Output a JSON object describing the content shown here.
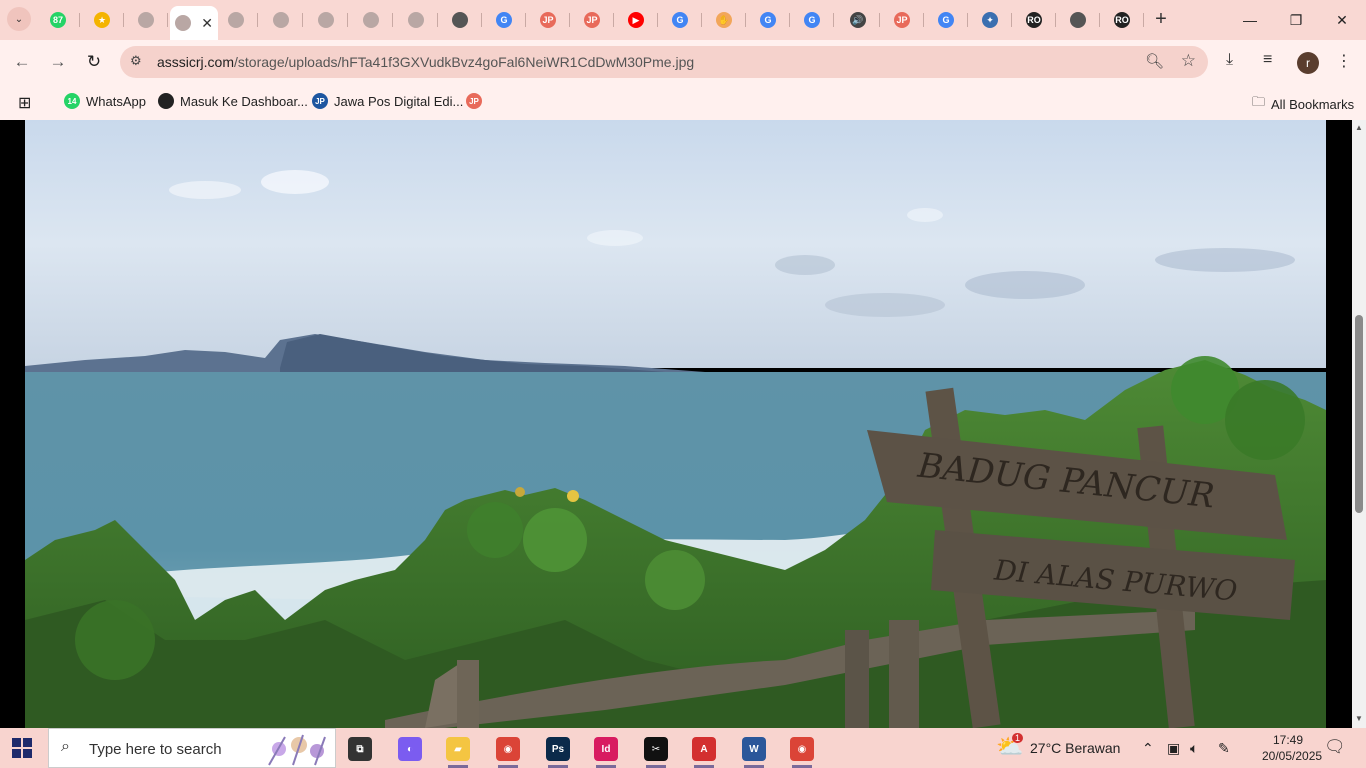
{
  "browser": {
    "tab_search_label": "⌄",
    "tabs": [
      {
        "icon": "whatsapp-icon",
        "badge": "87",
        "color": "#25d366"
      },
      {
        "icon": "star-icon",
        "badge": "★",
        "color": "#f4b400"
      },
      {
        "icon": "page-icon",
        "badge": "",
        "color": "#b9a7a4"
      },
      {
        "icon": "page-icon",
        "badge": "",
        "color": "#b9a7a4"
      },
      {
        "icon": "page-icon",
        "badge": "",
        "color": "#b9a7a4"
      },
      {
        "icon": "page-icon",
        "badge": "",
        "color": "#b9a7a4"
      },
      {
        "icon": "page-icon",
        "badge": "",
        "color": "#b9a7a4"
      },
      {
        "icon": "page-icon",
        "badge": "",
        "color": "#b9a7a4"
      },
      {
        "icon": "chrome-icon",
        "badge": "",
        "color": "#555555"
      },
      {
        "icon": "google-icon",
        "badge": "G",
        "color": "#4285f4"
      },
      {
        "icon": "jawapos-icon",
        "badge": "JP",
        "color": "#e86a5a"
      },
      {
        "icon": "jawapos-icon",
        "badge": "JP",
        "color": "#e86a5a"
      },
      {
        "icon": "youtube-icon",
        "badge": "▶",
        "color": "#ff0000"
      },
      {
        "icon": "google-icon",
        "badge": "G",
        "color": "#4285f4"
      },
      {
        "icon": "hand-icon",
        "badge": "✋",
        "color": "#f2a65a"
      },
      {
        "icon": "google-icon",
        "badge": "G",
        "color": "#4285f4"
      },
      {
        "icon": "google-icon",
        "badge": "G",
        "color": "#4285f4"
      },
      {
        "icon": "speaker-icon",
        "badge": "🔊",
        "color": "#444444"
      },
      {
        "icon": "jawapos-icon",
        "badge": "JP",
        "color": "#e86a5a"
      },
      {
        "icon": "google-icon",
        "badge": "G",
        "color": "#4285f4"
      },
      {
        "icon": "tool-icon",
        "badge": "✦",
        "color": "#3b6fb0"
      },
      {
        "icon": "ro-icon",
        "badge": "RO",
        "color": "#222222"
      },
      {
        "icon": "chrome-icon",
        "badge": "",
        "color": "#555555"
      },
      {
        "icon": "ro-icon",
        "badge": "RO",
        "color": "#222222"
      }
    ],
    "active_tab_close": "✕",
    "new_tab": "+",
    "window_controls": {
      "minimize": "—",
      "maximize": "❐",
      "close": "✕"
    },
    "back": "←",
    "forward": "→",
    "reload": "↻",
    "url_domain": "asssicrj.com",
    "url_path": "/storage/uploads/hFTa41f3GXVudkBvz4goFal6NeiWR1CdDwM30Pme.jpg",
    "avatar_letter": "r",
    "bookmarks": [
      {
        "label": "WhatsApp",
        "icon": "whatsapp-icon",
        "badge": "14",
        "color": "#25d366"
      },
      {
        "label": "Masuk Ke Dashboar...",
        "icon": "github-icon",
        "badge": "",
        "color": "#222222"
      },
      {
        "label": "Jawa Pos Digital Edi...",
        "icon": "jawapos-icon",
        "badge": "JP",
        "color": "#1e56a0"
      },
      {
        "label": "",
        "icon": "jawapos-icon",
        "badge": "JP",
        "color": "#e86a5a"
      }
    ],
    "all_bookmarks": "All Bookmarks"
  },
  "image": {
    "sign_top": "BADUG PANCUR",
    "sign_bottom": "DI ALAS PURWO"
  },
  "taskbar": {
    "search_placeholder": "Type here to search",
    "apps": [
      {
        "name": "task-view",
        "icon": "task-view-icon",
        "label": "⧉",
        "color": "#333333"
      },
      {
        "name": "copilot",
        "icon": "copilot-icon",
        "label": "◐",
        "color": "#7b5cf0"
      },
      {
        "name": "file-explorer",
        "icon": "folder-icon",
        "label": "▰",
        "color": "#f4c542"
      },
      {
        "name": "chrome",
        "icon": "chrome-icon",
        "label": "◉",
        "color": "#db4437"
      },
      {
        "name": "photoshop",
        "icon": "photoshop-icon",
        "label": "Ps",
        "color": "#0b2a4a"
      },
      {
        "name": "indesign",
        "icon": "indesign-icon",
        "label": "Id",
        "color": "#d81b60"
      },
      {
        "name": "capcut",
        "icon": "capcut-icon",
        "label": "✂",
        "color": "#111111"
      },
      {
        "name": "acrobat",
        "icon": "acrobat-icon",
        "label": "A",
        "color": "#d32f2f"
      },
      {
        "name": "word",
        "icon": "word-icon",
        "label": "W",
        "color": "#2b579a"
      },
      {
        "name": "chrome-profile",
        "icon": "chrome-icon",
        "label": "◉",
        "color": "#db4437"
      }
    ],
    "weather_badge": "1",
    "weather_text": "27°C  Berawan",
    "time": "17:49",
    "date": "20/05/2025"
  }
}
